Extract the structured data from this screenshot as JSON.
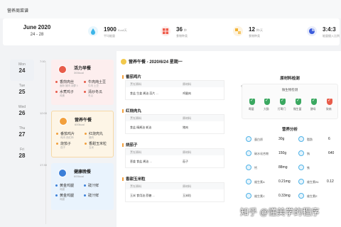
{
  "app": {
    "title": "营养周菜谱"
  },
  "header": {
    "month": "June 2020",
    "range": "24 - 28",
    "stats": [
      {
        "value": "1900",
        "unit": "Kcal/天",
        "label": "平均能量",
        "color": "#3db5e8",
        "icon": "water-drop-icon"
      },
      {
        "value": "36",
        "unit": "种",
        "label": "食物种类",
        "color": "#ef5b4b",
        "icon": "grid-icon"
      },
      {
        "value": "12",
        "unit": "种/天",
        "label": "食物种类",
        "color": "#f2b233",
        "icon": "squares-icon"
      },
      {
        "value": "3:4:3",
        "unit": "",
        "label": "能量摄入比例",
        "color": "#3b5bdb",
        "icon": "pie-chart-icon"
      }
    ]
  },
  "days": [
    {
      "weekday": "Mon",
      "date": "24"
    },
    {
      "weekday": "Tue",
      "date": "25"
    },
    {
      "weekday": "Wed",
      "date": "26"
    },
    {
      "weekday": "Thu",
      "date": "27"
    },
    {
      "weekday": "Fri",
      "date": "28"
    }
  ],
  "times": [
    "7:00",
    "12:00",
    "17:30"
  ],
  "meals": [
    {
      "title": "活力早餐",
      "kcal": "300kcal",
      "bg": "#fdeeee",
      "accent": "#e85c4a",
      "icon": "breakfast-icon",
      "items": [
        {
          "name": "香煎肉丝",
          "sub": "面粉 猪肉 胡萝卜"
        },
        {
          "name": "牛肉炖土豆",
          "sub": "牛肉 土豆"
        },
        {
          "name": "水煮鸡子",
          "sub": "鸡蛋"
        },
        {
          "name": "清炒冬瓜",
          "sub": "冬瓜"
        }
      ]
    },
    {
      "title": "营养午餐",
      "kcal": "600kcal",
      "bg": "#fdf5e6",
      "accent": "#f2a03d",
      "icon": "lunch-icon",
      "items": [
        {
          "name": "番茄鸡片",
          "sub": "鸡肉 西红柿"
        },
        {
          "name": "红烧肉丸",
          "sub": "猪肉"
        },
        {
          "name": "烧茄子",
          "sub": "茄子"
        },
        {
          "name": "香甜玉米粒",
          "sub": "玉米"
        }
      ]
    },
    {
      "title": "健康晚餐",
      "kcal": "600kcal",
      "bg": "#e9f3fd",
      "accent": "#3b7fd8",
      "icon": "dinner-icon",
      "items": [
        {
          "name": "黄金鸡腿",
          "sub": "鸡腿"
        },
        {
          "name": "豉汁鲜",
          "sub": ""
        },
        {
          "name": "黄金鸡腿",
          "sub": "鸡腿"
        },
        {
          "name": "豉汁鲜",
          "sub": ""
        }
      ]
    }
  ],
  "detail": {
    "heading": "营养午餐 - 2020/6/24 星期一",
    "col_desc": "烹饪原料",
    "col_raw": "原材料",
    "dishes": [
      {
        "name": "番茄鸡片",
        "desc": "食盐 生姜 酱油 蒜片 ...",
        "raw": "鸡腿肉"
      },
      {
        "name": "红烧肉丸",
        "desc": "食盐 精酱油 蚝油",
        "raw": "猪肉"
      },
      {
        "name": "烧茄子",
        "desc": "葱姜 食盐 酱油 ...",
        "raw": "茄子"
      },
      {
        "name": "香甜玉米粒",
        "desc": "玉米 食用油 蔗糖 ...",
        "raw": "玉米粒"
      }
    ]
  },
  "inspection": {
    "title": "原材料检测",
    "card_title": "微生物检测",
    "items": [
      {
        "label": "霉菌",
        "color": "#3aa860"
      },
      {
        "label": "大肠",
        "color": "#3aa860"
      },
      {
        "label": "打霉门",
        "color": "#3aa860"
      },
      {
        "label": "微生菌",
        "color": "#3aa860"
      },
      {
        "label": "酵母",
        "color": "#3aa860"
      },
      {
        "label": "致病",
        "color": "#e85c4a"
      }
    ]
  },
  "nutrition": {
    "title": "营养分析",
    "left": [
      {
        "name": "蛋白质",
        "value": "30g"
      },
      {
        "name": "碳水化合物",
        "value": "150g"
      },
      {
        "name": "钙",
        "value": "88mg"
      },
      {
        "name": "维生素A",
        "value": "0.21mg"
      },
      {
        "name": "维生素C",
        "value": "0.33mg"
      }
    ],
    "right": [
      {
        "name": "脂肪",
        "value": "6"
      },
      {
        "name": "钠",
        "value": "640"
      },
      {
        "name": "铁",
        "value": ""
      },
      {
        "name": "维生素B1",
        "value": "0.12"
      },
      {
        "name": "维生素E",
        "value": ""
      }
    ]
  },
  "watermark": "知乎 @懂美学的程序"
}
